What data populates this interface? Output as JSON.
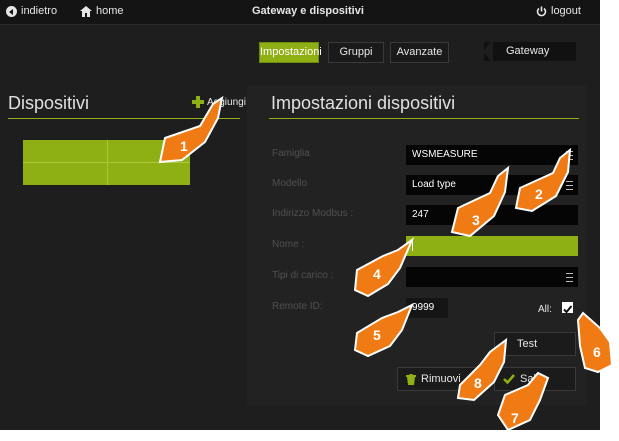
{
  "topbar": {
    "back_label": "indietro",
    "home_label": "home",
    "title": "Gateway e dispositivi",
    "logout_label": "logout"
  },
  "tabs": [
    {
      "label": "Impostazioni",
      "active": true
    },
    {
      "label": "Gruppi",
      "active": false
    },
    {
      "label": "Avanzate",
      "active": false
    }
  ],
  "gateway_tab": "Gateway",
  "left": {
    "title": "Dispositivi",
    "add_label": "Aggiungi"
  },
  "right": {
    "title": "Impostazioni dispositivi",
    "fields": {
      "famiglia": {
        "label": "Famiglia",
        "value": "WSMEASURE"
      },
      "modello": {
        "label": "Modello",
        "value": "Load type"
      },
      "indirizzo": {
        "label": "Indirizzo Modbus :",
        "value": "247"
      },
      "nome": {
        "label": "Nome :",
        "value": ""
      },
      "tipi": {
        "label": "Tipi di carico :",
        "value": ""
      },
      "remote": {
        "label": "Remote ID:",
        "value": "9999"
      }
    },
    "all_label": "All:",
    "all_checked": true,
    "test_label": "Test",
    "remove_label": "Rimuovi",
    "save_label": "Salva"
  },
  "callouts": [
    "1",
    "2",
    "3",
    "4",
    "5",
    "6",
    "7",
    "8"
  ],
  "colors": {
    "accent": "#8fb014",
    "background": "#1e1e1e",
    "callout": "#f07a14"
  }
}
